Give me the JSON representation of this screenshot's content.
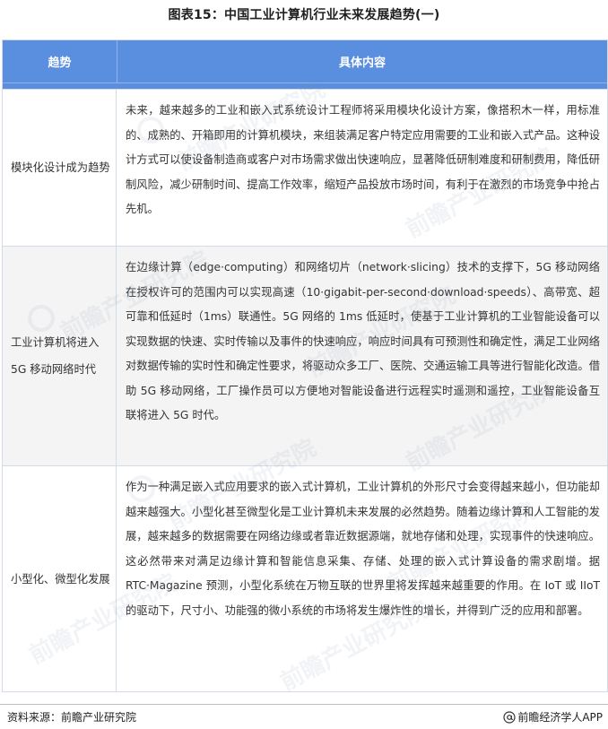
{
  "title": "图表15：中国工业计算机行业未来发展趋势(一)",
  "table": {
    "headers": {
      "trend": "趋势",
      "content": "具体内容"
    },
    "rows": [
      {
        "trend": "模块化设计成为趋势",
        "content": "未来，越来越多的工业和嵌入式系统设计工程师将采用模块化设计方案，像搭积木一样，用标准的、成熟的、开箱即用的计算机模块，来组装满足客户特定应用需要的工业和嵌入式产品。这种设计方式可以使设备制造商或客户对市场需求做出快速响应，显著降低研制难度和研制费用，降低研制风险，减少研制时间、提高工作效率，缩短产品投放市场时间，有利于在激烈的市场竞争中抢占先机。"
      },
      {
        "trend": "工业计算机将进入5G 移动网络时代",
        "content": "在边缘计算（edge·computing）和网络切片（network·slicing）技术的支撑下，5G 移动网络在授权许可的范围内可以实现高速（10·gigabit-per-second·download·speeds）、高带宽、超可靠和低延时（1ms）联通性。5G 网络的 1ms 低延时，使基于工业计算机的工业智能设备可以实现数据的快速、实时传输以及事件的快速响应，响应时间具有可预测性和确定性，满足工业网络对数据传输的实时性和确定性要求，将驱动众多工厂、医院、交通运输工具等进行智能化改造。借助 5G 移动网络，工厂操作员可以方便地对智能设备进行远程实时遥测和遥控，工业智能设备互联将进入 5G 时代。"
      },
      {
        "trend": "小型化、微型化发展",
        "content": "作为一种满足嵌入式应用要求的嵌入式计算机，工业计算机的外形尺寸会变得越来越小，但功能却越来越强大。小型化甚至微型化是工业计算机未来发展的必然趋势。随着边缘计算和人工智能的发展，越来越多的数据需要在网络边缘或者靠近数据源端，就地存储和处理，实现事件的快速响应。这必然带来对满足边缘计算和智能信息采集、存储、处理的嵌入式计算设备的需求剧增。据 RTC·Magazine 预测，小型化系统在万物互联的世界里将发挥越来越重要的作用。在 IoT 或 IIoT 的驱动下，尺寸小、功能强的微小系统的市场将发生爆炸性的增长，并得到广泛的应用和部署。"
      }
    ]
  },
  "watermark": "前瞻产业研究院",
  "footer": {
    "source": "资料来源：前瞻产业研究院",
    "brand": "前瞻经济学人APP"
  }
}
